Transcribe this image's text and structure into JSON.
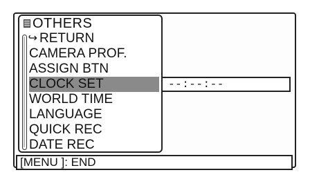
{
  "menu": {
    "title": "OTHERS",
    "items": [
      {
        "label": "RETURN",
        "icon": "return-icon"
      },
      {
        "label": "CAMERA PROF."
      },
      {
        "label": "ASSIGN BTN"
      },
      {
        "label": "CLOCK SET",
        "selected": true
      },
      {
        "label": "WORLD TIME"
      },
      {
        "label": "LANGUAGE"
      },
      {
        "label": "QUICK REC"
      },
      {
        "label": "DATE REC"
      }
    ]
  },
  "selected_value": "--:--:--",
  "footer": "[MENU ]: END",
  "colors": {
    "highlight": "#8a8a8a",
    "border": "#222222"
  }
}
